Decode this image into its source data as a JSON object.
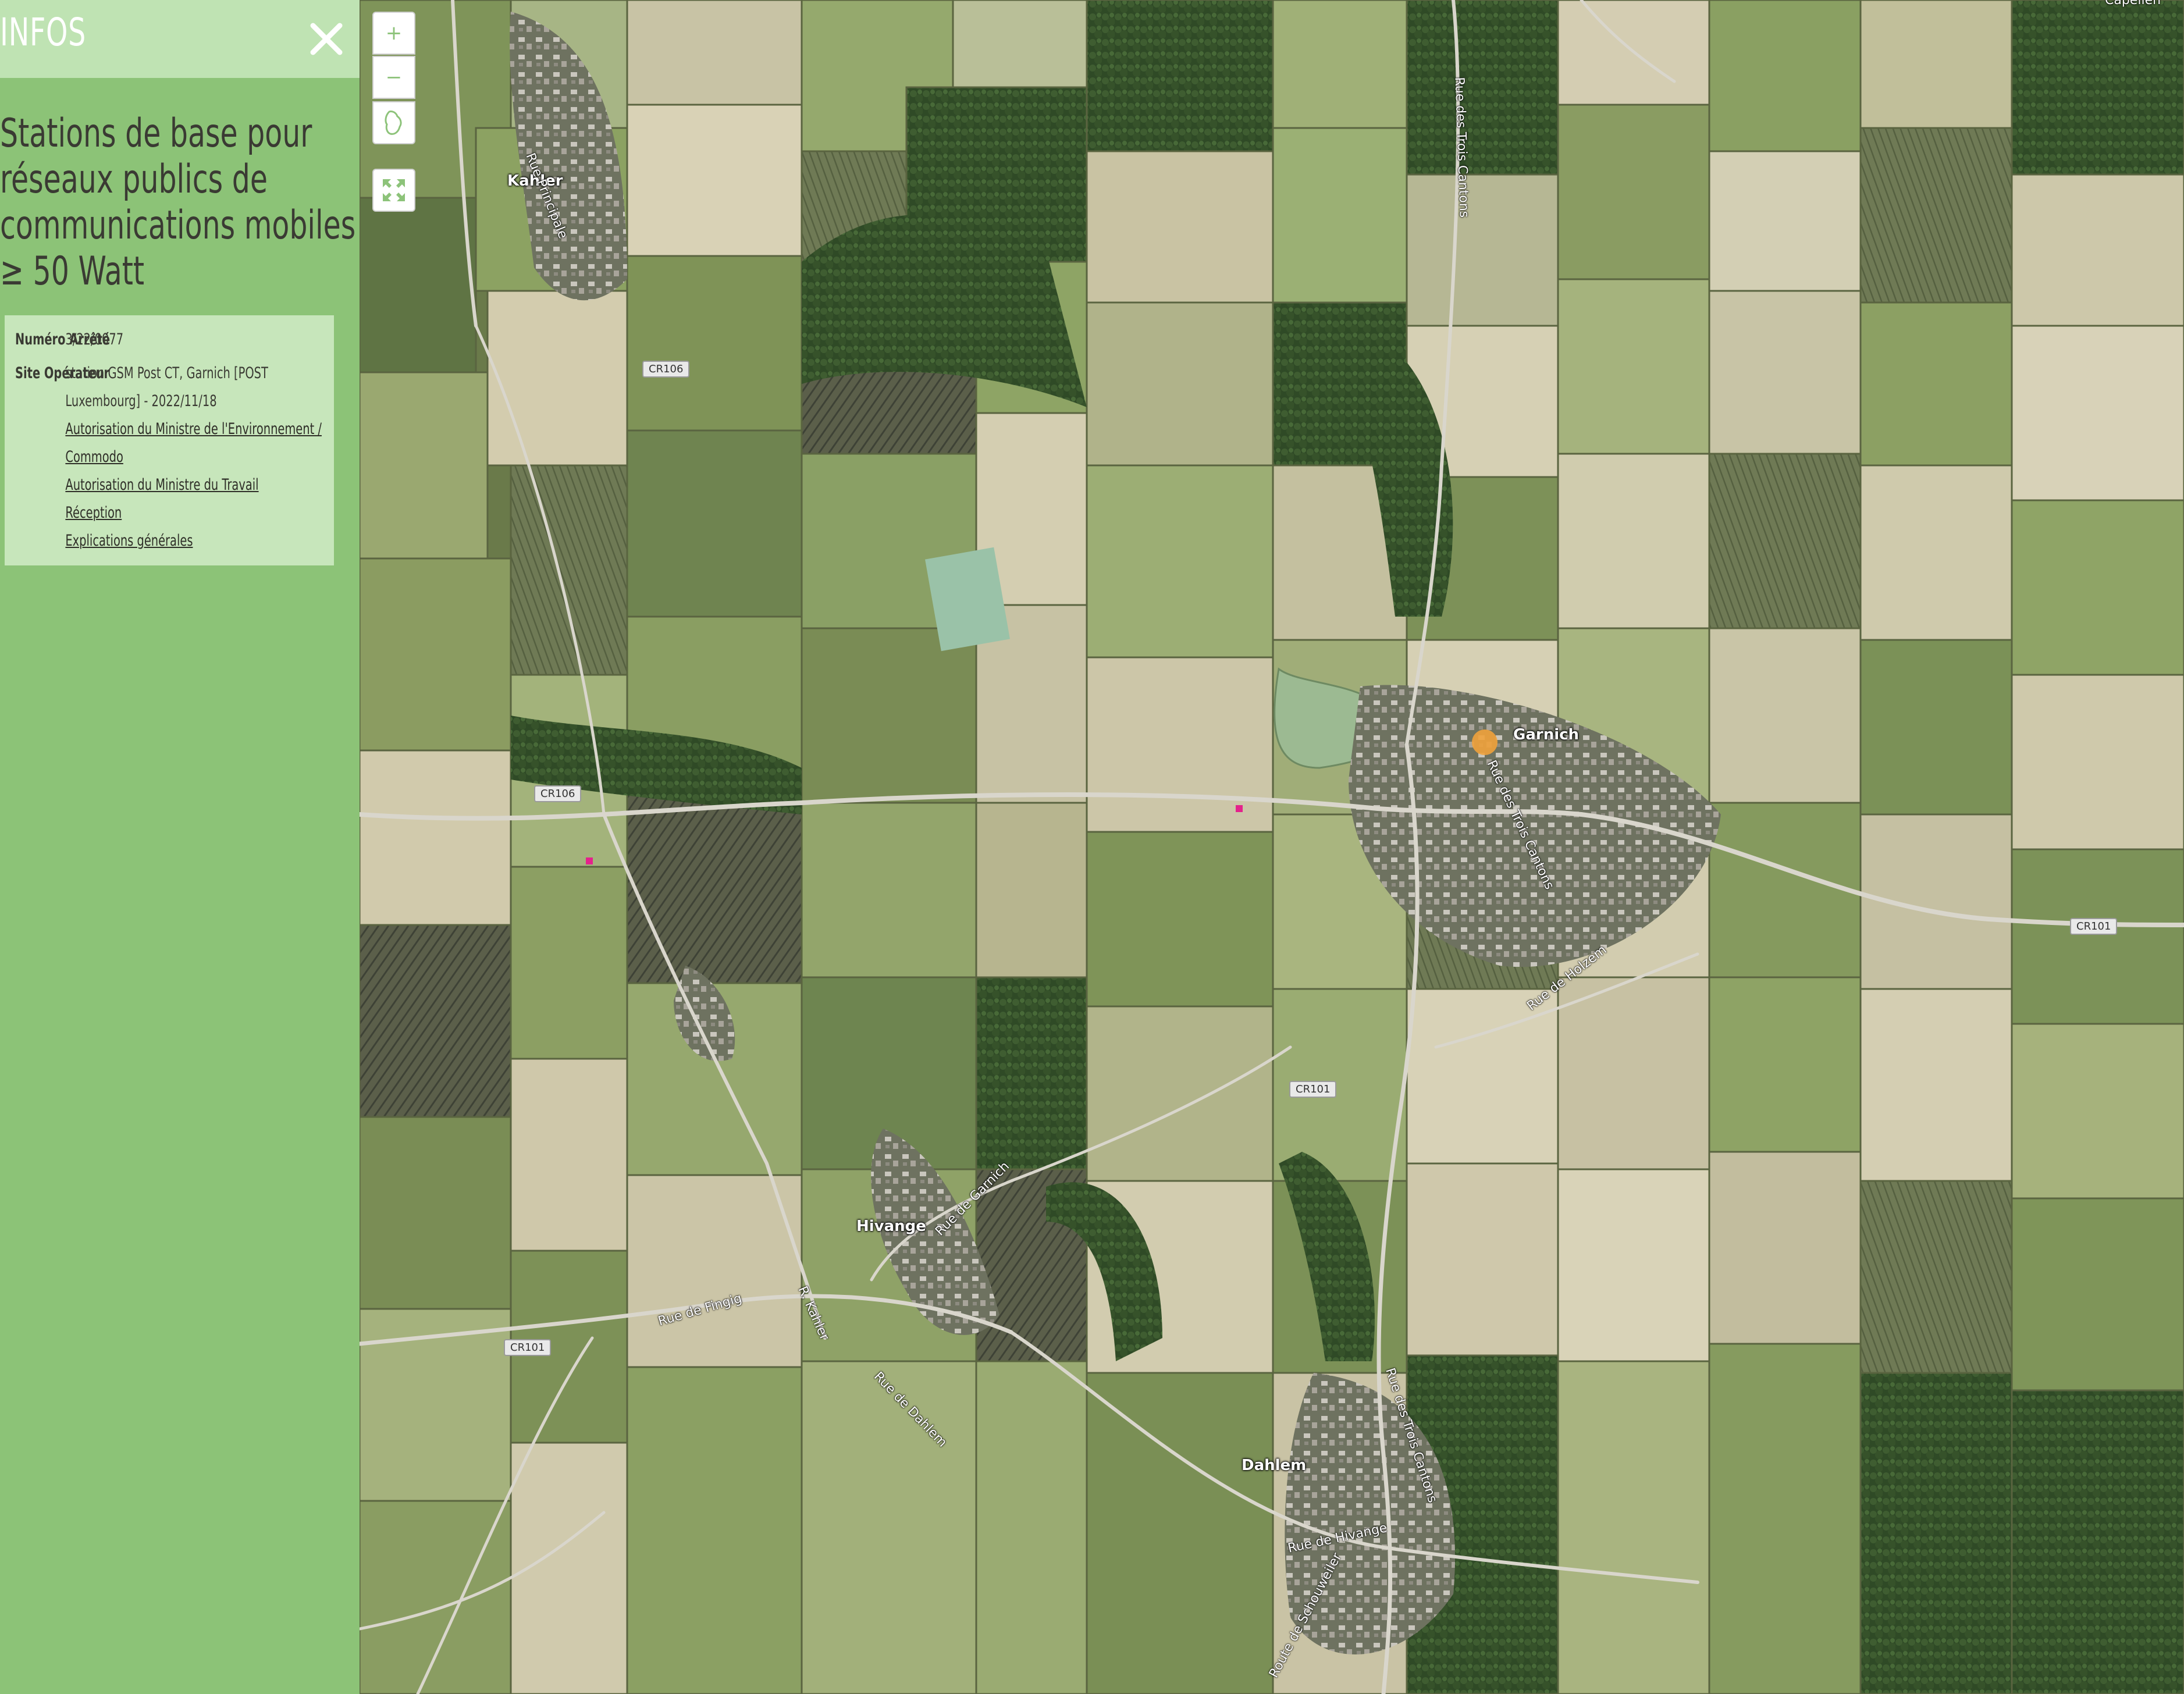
{
  "sidebar": {
    "heading": "INFOS",
    "close_icon": "close-icon",
    "layer_title": "Stations de base pour réseaux publics de communications mobiles ≥ 50 Watt",
    "fields": [
      {
        "key": "Numéro Arrêté",
        "value": "3/22/0077"
      },
      {
        "key": "Site Opérateur",
        "value": "station GSM Post CT, Garnich [POST Luxembourg] - 2022/11/18"
      }
    ],
    "links": [
      "Autorisation du Ministre de l'Environnement / Commodo",
      "Autorisation du Ministre du Travail",
      "Réception",
      "Explications générales"
    ],
    "colors": {
      "panel": "#8cc377",
      "header": "#bfe3b3",
      "box": "#c7e6bb",
      "text": "#3a3a33"
    }
  },
  "map_controls": {
    "zoom_in": "+",
    "zoom_out": "−",
    "home_icon": "luxembourg-outline-icon",
    "fullscreen_icon": "fullscreen-expand-icon",
    "accent": "#8dc37a"
  },
  "map": {
    "places": [
      "Kahler",
      "Garnich",
      "Hivange",
      "Dahlem"
    ],
    "streets": [
      "Rue Principale",
      "Rue des Trois Cantons",
      "Rue des Trois Cantons",
      "Rue des Trois Cantons",
      "Rue de Holzem",
      "Rue de Garnich",
      "Rue de Fingig",
      "R. Kahler",
      "Rue de Dahlem",
      "Rue de Hivange",
      "Route de Schouweiler"
    ],
    "road_badges": [
      "CR106",
      "CR106",
      "CR101",
      "CR101",
      "CR101"
    ],
    "top_right_label": "Capellen",
    "marker_colors": {
      "selected": "#f0a23c",
      "other": "#e4228c"
    }
  }
}
